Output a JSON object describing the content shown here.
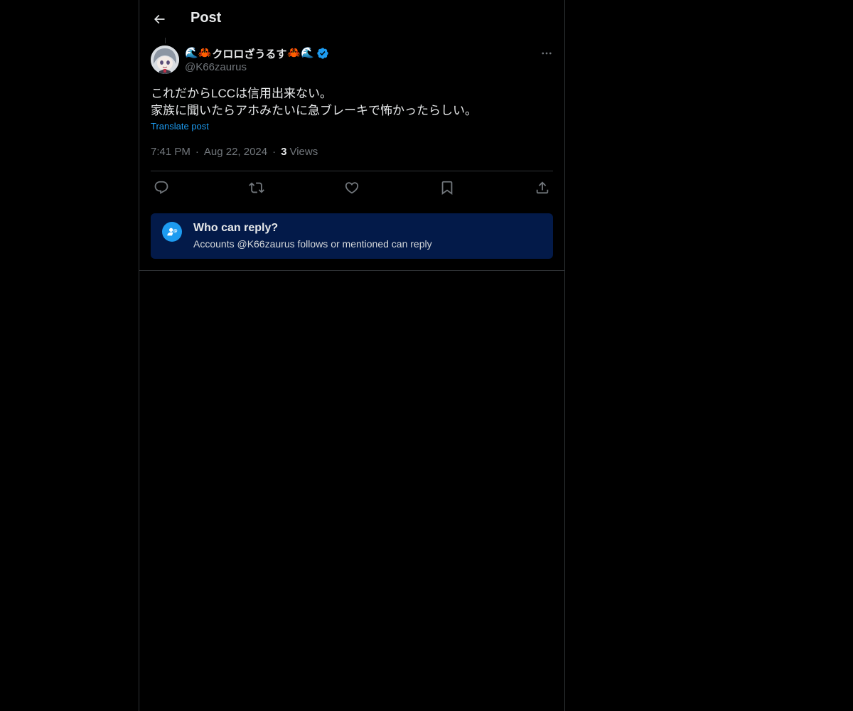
{
  "header": {
    "title": "Post"
  },
  "author": {
    "emoji_left": [
      "🌊",
      "🦀"
    ],
    "display_name": "クロロざうるす",
    "emoji_right": [
      "🦀",
      "🌊"
    ],
    "handle": "@K66zaurus",
    "verified": true
  },
  "tweet": {
    "text": "これだからLCCは信用出来ない。\n家族に聞いたらアホみたいに急ブレーキで怖かったらしい。",
    "translate_label": "Translate post",
    "time": "7:41 PM",
    "separator": "·",
    "date": "Aug 22, 2024",
    "views_count": "3",
    "views_label": "Views"
  },
  "actions": {
    "icons": [
      "reply-icon",
      "retweet-icon",
      "like-icon",
      "bookmark-icon",
      "share-icon"
    ]
  },
  "reply_restriction": {
    "title": "Who can reply?",
    "subtitle": "Accounts @K66zaurus follows or mentioned can reply"
  },
  "colors": {
    "background": "#000000",
    "border": "#2f3336",
    "accent": "#1d9bf0",
    "muted": "#71767b",
    "text": "#e7e9ea",
    "reply_box_bg": "#031a49"
  }
}
